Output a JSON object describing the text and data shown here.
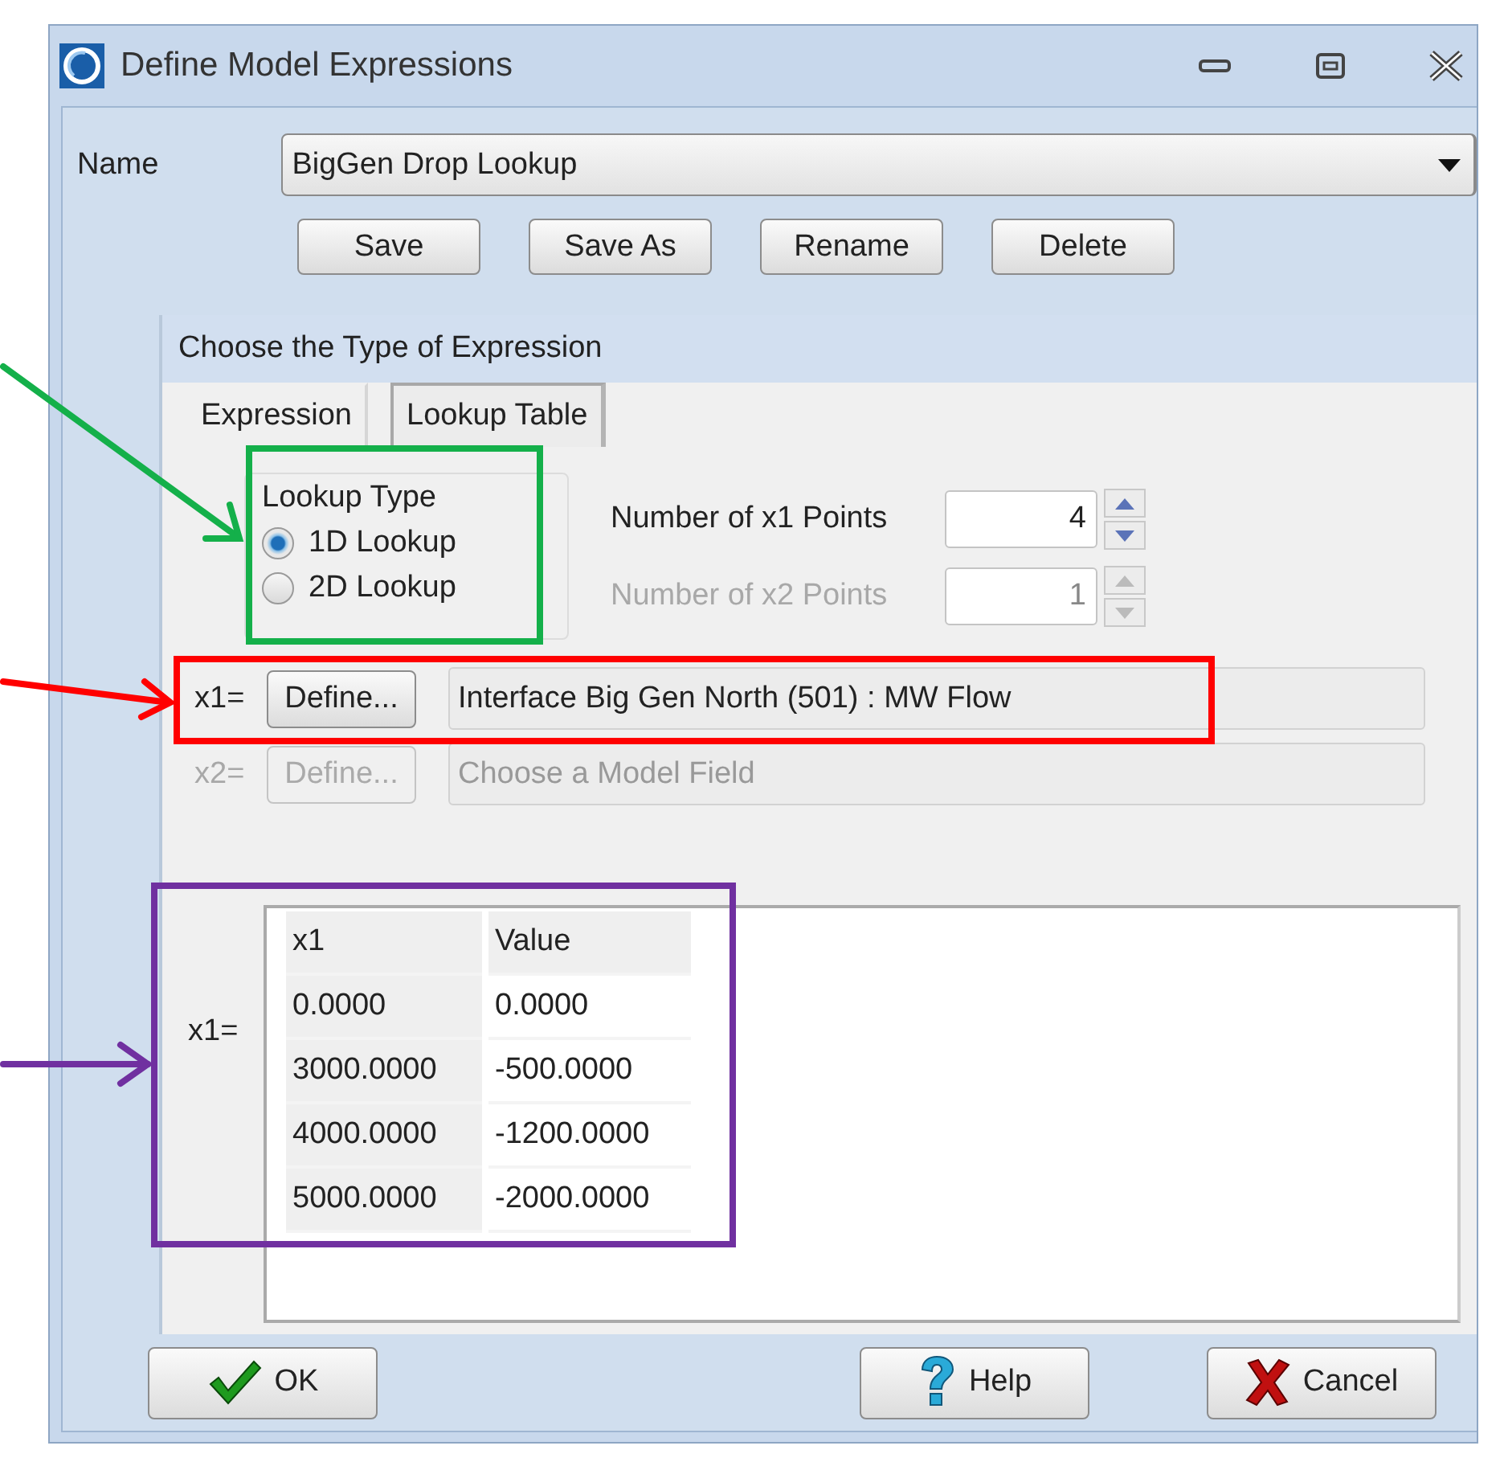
{
  "window": {
    "title": "Define Model Expressions"
  },
  "name": {
    "label": "Name",
    "value": "BigGen Drop Lookup"
  },
  "actions": [
    "Save",
    "Save As",
    "Rename",
    "Delete"
  ],
  "section": {
    "title": "Choose the Type of Expression"
  },
  "tabs": [
    {
      "label": "Expression",
      "selected": false
    },
    {
      "label": "Lookup Table",
      "selected": true
    }
  ],
  "lookup_type": {
    "title": "Lookup Type",
    "options": [
      {
        "label": "1D Lookup",
        "selected": true
      },
      {
        "label": "2D Lookup",
        "selected": false
      }
    ]
  },
  "points": [
    {
      "label": "Number of x1 Points",
      "value": "4",
      "disabled": false
    },
    {
      "label": "Number of x2 Points",
      "value": "1",
      "disabled": true
    }
  ],
  "fields": [
    {
      "label": "x1=",
      "button": "Define...",
      "value": "Interface Big Gen North (501) : MW Flow",
      "disabled": false
    },
    {
      "label": "x2=",
      "button": "Define...",
      "value": "Choose a Model Field",
      "disabled": true
    }
  ],
  "table": {
    "label": "x1=",
    "columns": [
      "x1",
      "Value"
    ],
    "rows": [
      [
        "0.0000",
        "0.0000"
      ],
      [
        "3000.0000",
        "-500.0000"
      ],
      [
        "4000.0000",
        "-1200.0000"
      ],
      [
        "5000.0000",
        "-2000.0000"
      ]
    ]
  },
  "footer": [
    {
      "label": "OK",
      "kind": "ok"
    },
    {
      "label": "Help",
      "kind": "help"
    },
    {
      "label": "Cancel",
      "kind": "cancel"
    }
  ]
}
